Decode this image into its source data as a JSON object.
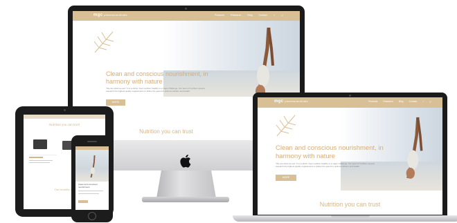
{
  "site": {
    "brand": "mgc",
    "brand_sub": "pharmaceuticals",
    "nav_links": [
      "Products",
      "Research",
      "Blog",
      "Contact"
    ],
    "headline_line1": "Clean and conscious nourishment, in",
    "headline_line2": "harmony with nature",
    "body": "\"We are what we eat.\" It is a cliché. Kept nutrition healthy is a major challenge. Our team of nutrition experts research the highest quality supplements to follow the quest for optimal nutrition and health.",
    "more_label": "MORE",
    "section_title": "Nutrition you can trust",
    "tablet_section_title": "Nutrition you can trust",
    "tablet_benefits_title": "The benefits of our",
    "phone_caption": "Clean and conscious nourishment"
  },
  "colors": {
    "accent": "#d9bf96",
    "headline": "#d5ad78",
    "frame": "#1b1b1b"
  },
  "icons": [
    "leaf-logo-icon",
    "apple-logo-icon",
    "search-icon",
    "cart-icon"
  ]
}
